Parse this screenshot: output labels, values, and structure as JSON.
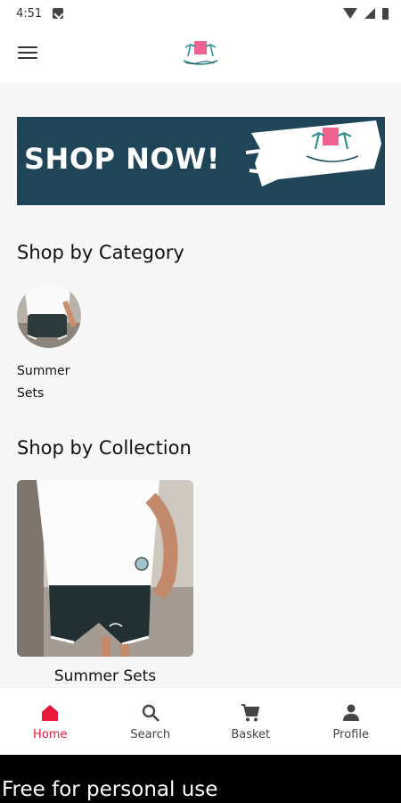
{
  "status_bar": {
    "time": "4:51"
  },
  "banner": {
    "text": "SHOP NOW!"
  },
  "sections": {
    "category_title": "Shop by Category",
    "collection_title": "Shop by Collection"
  },
  "categories": [
    {
      "label": "Summer Sets"
    }
  ],
  "collections": [
    {
      "label": "Summer Sets"
    }
  ],
  "bottom_nav": [
    {
      "label": "Home",
      "icon": "home-icon",
      "active": true
    },
    {
      "label": "Search",
      "icon": "search-icon",
      "active": false
    },
    {
      "label": "Basket",
      "icon": "cart-icon",
      "active": false
    },
    {
      "label": "Profile",
      "icon": "person-icon",
      "active": false
    }
  ],
  "footer": {
    "text": "Free for personal use"
  },
  "colors": {
    "accent": "#e8173c",
    "banner_bg": "#214558"
  }
}
